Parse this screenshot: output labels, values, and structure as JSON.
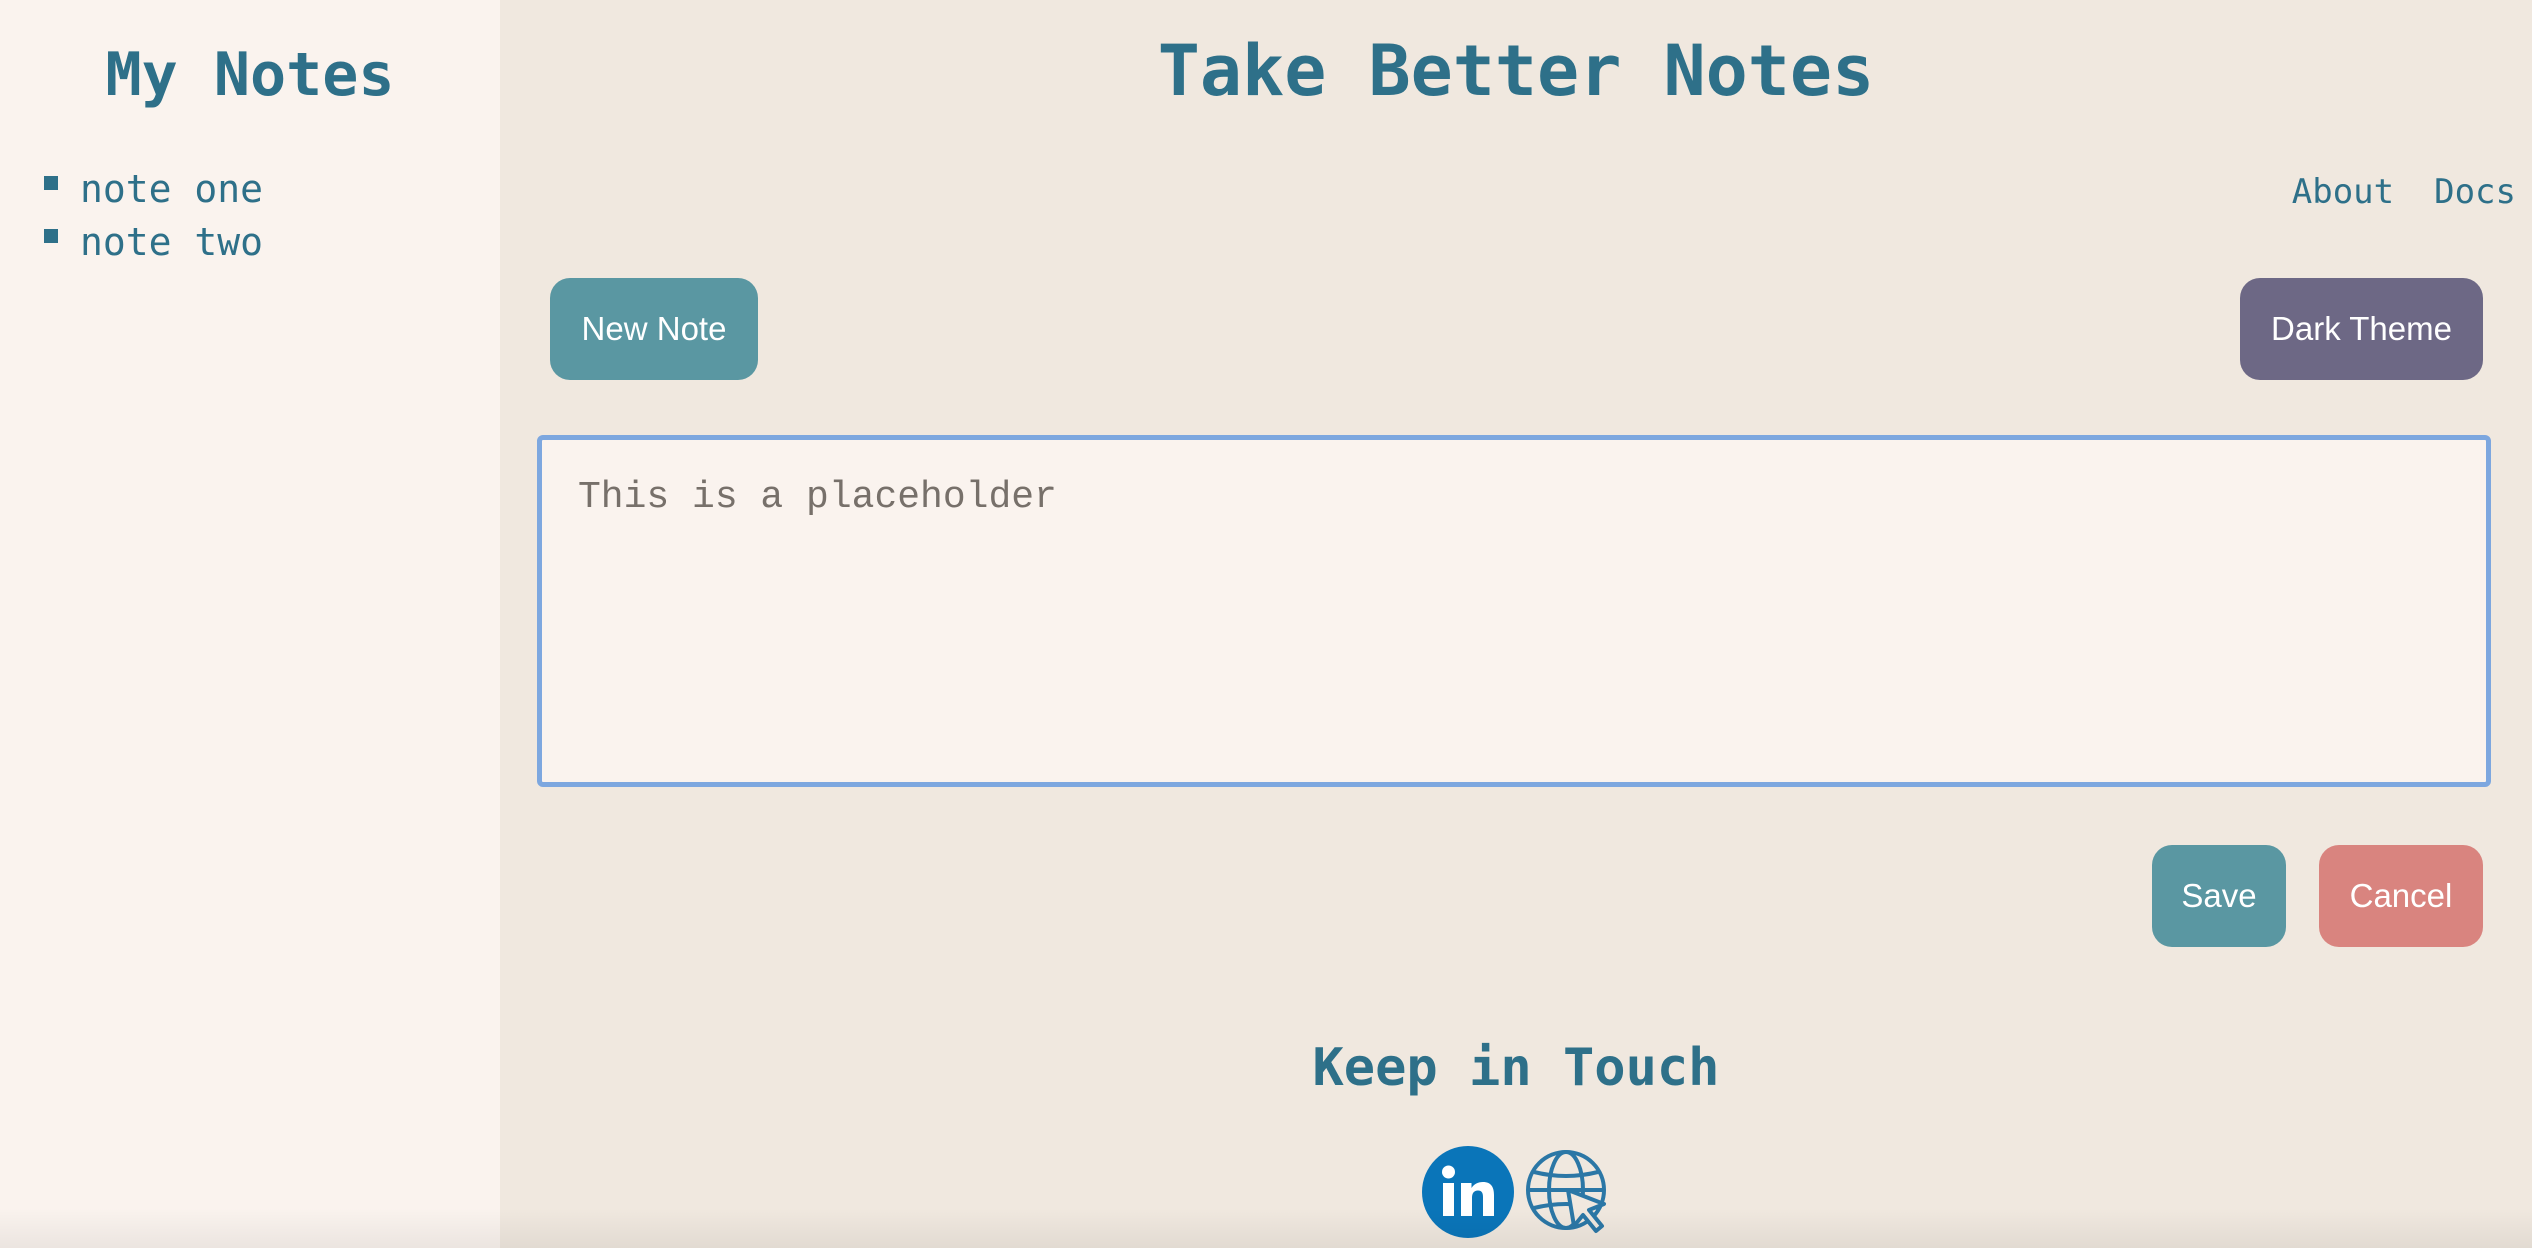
{
  "sidebar": {
    "title": "My Notes",
    "notes": [
      "note one",
      "note two"
    ]
  },
  "header": {
    "title": "Take Better Notes",
    "nav": {
      "about": "About",
      "docs": "Docs"
    }
  },
  "toolbar": {
    "new_note_label": "New Note",
    "dark_theme_label": "Dark Theme"
  },
  "editor": {
    "placeholder": "This is a placeholder",
    "value": ""
  },
  "actions": {
    "save_label": "Save",
    "cancel_label": "Cancel"
  },
  "footer": {
    "title": "Keep in Touch",
    "links": [
      "linkedin-icon",
      "globe-cursor-icon"
    ]
  },
  "colors": {
    "accent": "#2e7089",
    "primary_button": "#5a97a2",
    "dark_theme_button": "#6d6885",
    "cancel_button": "#d9847f",
    "focus_border": "#7da7df",
    "linkedin": "#0a75b9"
  }
}
